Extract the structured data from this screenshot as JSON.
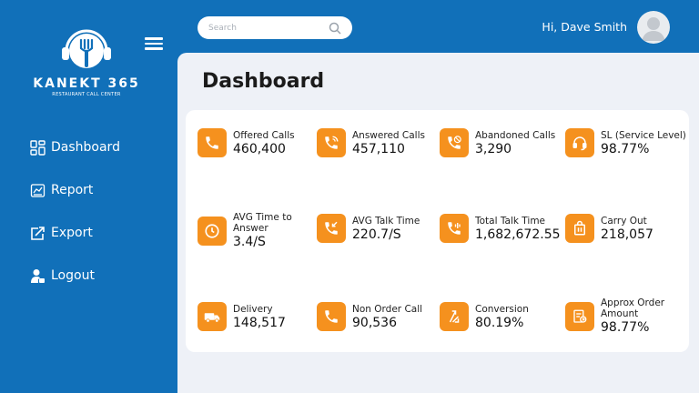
{
  "brand": {
    "name": "KANEKT 365",
    "tagline": "RESTAURANT CALL CENTER"
  },
  "nav": [
    {
      "label": "Dashboard",
      "icon": "dashboard-icon"
    },
    {
      "label": "Report",
      "icon": "report-icon"
    },
    {
      "label": "Export",
      "icon": "export-icon"
    },
    {
      "label": "Logout",
      "icon": "logout-icon"
    }
  ],
  "search": {
    "placeholder": "Search"
  },
  "user": {
    "greeting": "Hi, Dave Smith"
  },
  "page": {
    "title": "Dashboard"
  },
  "colors": {
    "primary": "#1170b9",
    "accent": "#f5911e",
    "background": "#eef1f7"
  },
  "stats": [
    {
      "label": "Offered Calls",
      "value": "460,400",
      "icon": "phone-icon"
    },
    {
      "label": "Answered Calls",
      "value": "457,110",
      "icon": "phone-ringing-icon"
    },
    {
      "label": "Abandoned Calls",
      "value": "3,290",
      "icon": "phone-missed-icon"
    },
    {
      "label": "SL (Service Level)",
      "value": "98.77%",
      "icon": "headset-icon"
    },
    {
      "label": "AVG Time to Answer",
      "value": "3.4/S",
      "icon": "clock-icon"
    },
    {
      "label": "AVG Talk Time",
      "value": "220.7/S",
      "icon": "phone-incoming-icon"
    },
    {
      "label": "Total Talk Time",
      "value": "1,682,672.55",
      "icon": "phone-talk-icon"
    },
    {
      "label": "Carry Out",
      "value": "218,057",
      "icon": "takeaway-bag-icon"
    },
    {
      "label": "Delivery",
      "value": "148,517",
      "icon": "delivery-truck-icon"
    },
    {
      "label": "Non Order Call",
      "value": "90,536",
      "icon": "phone-icon"
    },
    {
      "label": "Conversion",
      "value": "80.19%",
      "icon": "conversion-icon"
    },
    {
      "label": "Approx Order Amount",
      "value": "98.77%",
      "icon": "invoice-icon"
    }
  ]
}
